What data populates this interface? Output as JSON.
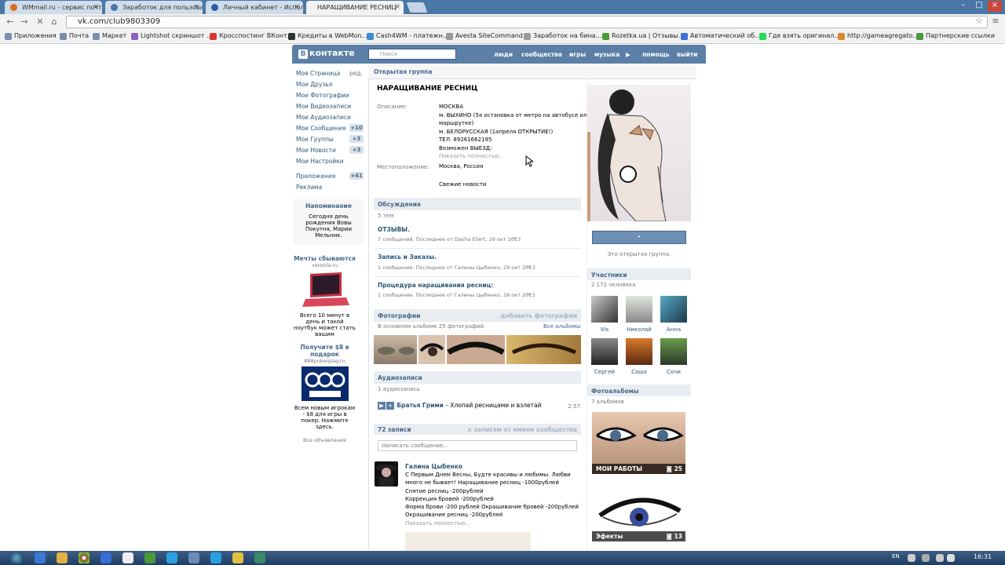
{
  "browser": {
    "tabs": [
      {
        "label": "WMmail.ru - сервис почто",
        "active": false
      },
      {
        "label": "Заработок для пользоват",
        "active": false
      },
      {
        "label": "Личный кабинет - Исполь",
        "active": false
      },
      {
        "label": "НАРАЩИВАНИЕ РЕСНИЦ",
        "active": true
      }
    ],
    "url": "vk.com/club9803309",
    "bookmarks": [
      "Приложения",
      "Почта",
      "Маркет",
      "Lightshot скриншот ...",
      "Кросспостинг ВКонт...",
      "Кредиты в WebMon...",
      "Cash4WM - платежн...",
      "Avesta SiteCommand...",
      "Заработок на бина...",
      "Rozetka.ua | Отзывы...",
      "Автоматический об...",
      "Где взять оригинал...",
      "http://gameagregato...",
      "Партнерские ссылки"
    ]
  },
  "vk_header": {
    "logo": "контакте",
    "search_placeholder": "Поиск",
    "nav": [
      "люди",
      "сообщества",
      "игры",
      "музыка",
      "помощь",
      "выйти"
    ]
  },
  "left_menu": {
    "items": [
      {
        "label": "Моя Страница",
        "extra": "ред."
      },
      {
        "label": "Мои Друзья"
      },
      {
        "label": "Мои Фотографии"
      },
      {
        "label": "Мои Видеозаписи"
      },
      {
        "label": "Мои Аудиозаписи"
      },
      {
        "label": "Мои Сообщения",
        "count": "+10"
      },
      {
        "label": "Мои Группы",
        "count": "+3"
      },
      {
        "label": "Мои Новости",
        "count": "+3"
      },
      {
        "label": "Мои Настройки"
      },
      {
        "label": "Приложения",
        "count": "+41"
      },
      {
        "label": "Реклама"
      }
    ],
    "reminder": {
      "title": "Напоминание",
      "body": "Сегодня день рождения Вовы Покутня, Марии Мельник."
    },
    "ads": [
      {
        "title": "Мечты сбываются",
        "site": "vorotila.ru",
        "text": "Всего 10 минут в день и такой ноутбук может стать вашим"
      },
      {
        "title": "Получите $8 в подарок",
        "site": "888pokerplay.ru",
        "text": "Всем новым игрокам - $8 для игры в покер. Нажмите здесь."
      }
    ],
    "all_ads": "Все объявления"
  },
  "group": {
    "type": "Открытая группа",
    "name": "НАРАЩИВАНИЕ РЕСНИЦ",
    "desc_label": "Описание:",
    "desc_lines": [
      "МОСКВА",
      "м. ВЫХИНО (5я остановка от метро на автобусе или",
      "маршрутке)",
      "м. БЕЛОРУССКАЯ (1апреля ОТКРЫТИЕ!)",
      "ТЕЛ. 89261662195",
      "Возможен ВЫЕЗД:"
    ],
    "show_more": "Показать полностью..",
    "location_label": "Местоположение:",
    "location": "Москва, Россия",
    "news": "Свежие новости"
  },
  "discussions": {
    "title": "Обсуждения",
    "count": "5 тем",
    "topics": [
      {
        "title": "ОТЗЫВЫ.",
        "meta": "7 сообщений. Последнее от Dasha Ellert, 29 окт 2013"
      },
      {
        "title": "Запись и Заказы.",
        "meta": "1 сообщение. Последнее от Галины Цыбенко, 29 окт 2013"
      },
      {
        "title": "Процедура наращивания ресниц:",
        "meta": "1 сообщение. Последнее от Галины Цыбенко, 28 окт 2013"
      }
    ]
  },
  "photos": {
    "title": "Фотографии",
    "add": "добавить фотографии",
    "sub": "В основном альбоме 25 фотографий",
    "all": "Все альбомы"
  },
  "audio": {
    "title": "Аудиозаписи",
    "count": "1 аудиозапись",
    "artist": "Братья Грими",
    "song": "– Хлопай ресницами и взлетай",
    "duration": "2:57"
  },
  "wall": {
    "count": "72 записи",
    "link": "к записям от имени сообщества",
    "placeholder": "Написать сообщение...",
    "post_author": "Галина Цыбенко",
    "post_lines": [
      "С Первым Днем Весны, Будте красивы и любимы. Любви",
      "много не бывает! Наращивание ресниц -1000рублей",
      "Снятие ресниц -200рублей",
      "Коррекция бровей -200рублей",
      "Форма брови -200 рублей Окрашивание бровей -200рублей",
      "Окрашивание ресниц -200рублей"
    ],
    "show_more": "Показать полностью.."
  },
  "right": {
    "join": "-",
    "open_note": "Это открытая группа.",
    "members_title": "Участники",
    "members_count": "2 172 человека",
    "members": [
      "Vis",
      "Николай",
      "Анна",
      "Сергей",
      "Саша",
      "Сочи"
    ],
    "albums_title": "Фотоальбомы",
    "albums_count": "7 альбомов",
    "albums": [
      {
        "name": "МОИ РАБОТЫ",
        "count": "25"
      },
      {
        "name": "Эфекты",
        "count": "13"
      }
    ]
  },
  "taskbar": {
    "lang": "EN",
    "time": "16:31"
  },
  "colors": {
    "vk_blue": "#5b7fa6",
    "link": "#2b587a",
    "accent": "#45688e"
  }
}
